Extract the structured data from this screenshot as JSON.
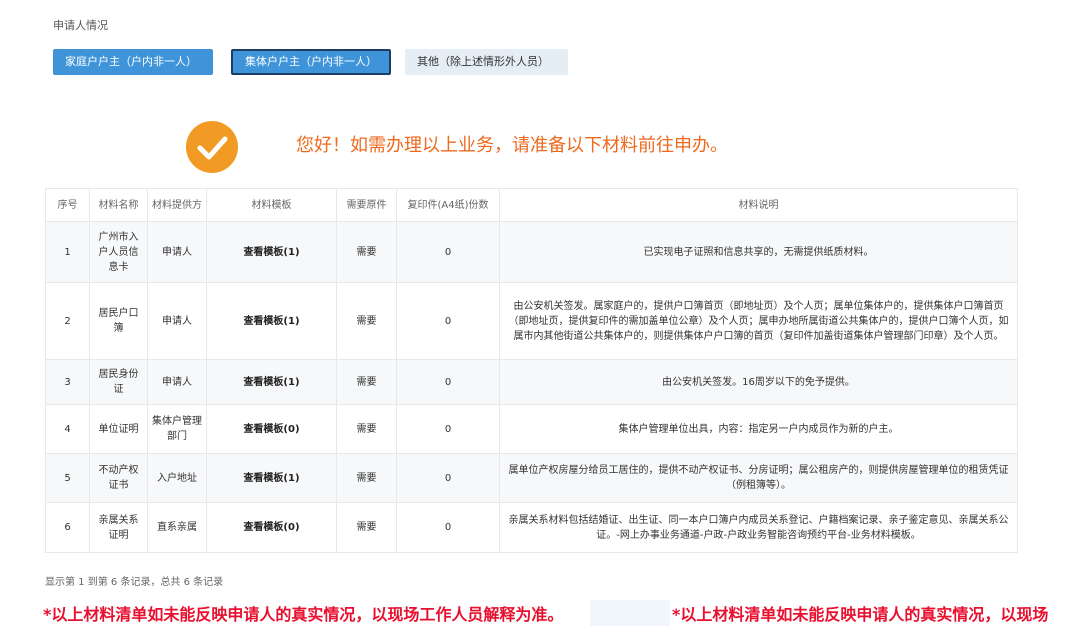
{
  "section_label": "申请人情况",
  "options": [
    {
      "label": "家庭户户主（户内非一人）"
    },
    {
      "label": "集体户户主（户内非一人）"
    },
    {
      "label": "其他（除上述情形外人员）"
    }
  ],
  "notice": "您好！如需办理以上业务，请准备以下材料前往申办。",
  "colors": {
    "accent": "#3f94d9",
    "check": "#f29b24",
    "notice": "#ee6a1e",
    "warn": "#e8102e"
  },
  "table": {
    "headers": [
      "序号",
      "材料名称",
      "材料提供方",
      "材料模板",
      "需要原件",
      "复印件(A4纸)份数",
      "材料说明"
    ],
    "rows": [
      {
        "no": "1",
        "name": "广州市入户人员信息卡",
        "provider": "申请人",
        "template": "查看模板(1)",
        "original": "需要",
        "copies": "0",
        "desc": "已实现电子证照和信息共享的，无需提供纸质材料。"
      },
      {
        "no": "2",
        "name": "居民户口簿",
        "provider": "申请人",
        "template": "查看模板(1)",
        "original": "需要",
        "copies": "0",
        "desc": "由公安机关签发。属家庭户的，提供户口簿首页（即地址页）及个人页；属单位集体户的，提供集体户口簿首页（即地址页，提供复印件的需加盖单位公章）及个人页；属申办地所属街道公共集体户的，提供户口簿个人页，如属市内其他街道公共集体户的，则提供集体户户口簿的首页（复印件加盖街道集体户管理部门印章）及个人页。"
      },
      {
        "no": "3",
        "name": "居民身份证",
        "provider": "申请人",
        "template": "查看模板(1)",
        "original": "需要",
        "copies": "0",
        "desc": "由公安机关签发。16周岁以下的免予提供。"
      },
      {
        "no": "4",
        "name": "单位证明",
        "provider": "集体户管理部门",
        "template": "查看模板(0)",
        "original": "需要",
        "copies": "0",
        "desc": "集体户管理单位出具，内容：指定另一户内成员作为新的户主。"
      },
      {
        "no": "5",
        "name": "不动产权证书",
        "provider": "入户地址",
        "template": "查看模板(1)",
        "original": "需要",
        "copies": "0",
        "desc": "属单位产权房屋分给员工居住的，提供不动产权证书、分房证明；属公租房产的，则提供房屋管理单位的租赁凭证（例租簿等）。"
      },
      {
        "no": "6",
        "name": "亲属关系证明",
        "provider": "直系亲属",
        "template": "查看模板(0)",
        "original": "需要",
        "copies": "0",
        "desc": "亲属关系材料包括结婚证、出生证、同一本户口簿户内成员关系登记、户籍档案记录、亲子鉴定意见、亲属关系公证。-网上办事业务通道-户政-户政业务智能咨询预约平台-业务材料模板。"
      }
    ]
  },
  "footer_count": "显示第 1 到第 6 条记录，总共 6 条记录",
  "warning_1": "*以上材料清单如未能反映申请人的真实情况，以现场工作人员解释为准。",
  "warning_2": "*以上材料清单如未能反映申请人的真实情况，以现场"
}
